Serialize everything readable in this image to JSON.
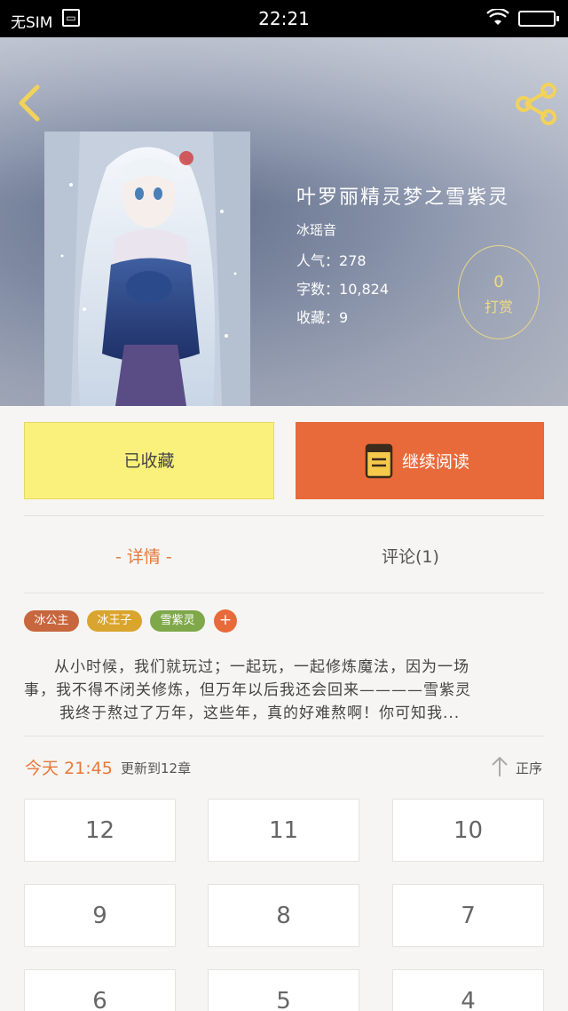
{
  "status_bar": {
    "sim": "无SIM",
    "time": "22:21"
  },
  "book": {
    "title": "叶罗丽精灵梦之雪紫灵",
    "author": "冰瑶音",
    "popularity_label": "人气：",
    "popularity": "278",
    "words_label": "字数：",
    "words": "10,824",
    "collects_label": "收藏：",
    "collects": "9"
  },
  "reward": {
    "count": "0",
    "label": "打赏"
  },
  "actions": {
    "collected_label": "已收藏",
    "continue_label": "继续阅读"
  },
  "tabs": {
    "detail": "- 详情 -",
    "comments": "评论(1)"
  },
  "tags": [
    {
      "label": "冰公主",
      "color": "#c8663e"
    },
    {
      "label": "冰王子",
      "color": "#d9a52e"
    },
    {
      "label": "雪紫灵",
      "color": "#7ea84a"
    }
  ],
  "tag_add": "+",
  "summary": {
    "line1": "从小时候，我们就玩过；一起玩，一起修炼魔法，因为一场",
    "line2": "事，我不得不闭关修炼，但万年以后我还会回来————雪紫灵",
    "line3": "我终于熬过了万年，这些年，真的好难熬啊！你可知我..."
  },
  "update": {
    "day": "今天",
    "time": "21:45",
    "text": "更新到12章",
    "sort_label": "正序"
  },
  "chapters": [
    "12",
    "11",
    "10",
    "9",
    "8",
    "7",
    "6",
    "5",
    "4"
  ],
  "colors": {
    "accent": "#e8783a",
    "collected_bg": "#faf17d",
    "read_bg": "#e86a3a"
  }
}
